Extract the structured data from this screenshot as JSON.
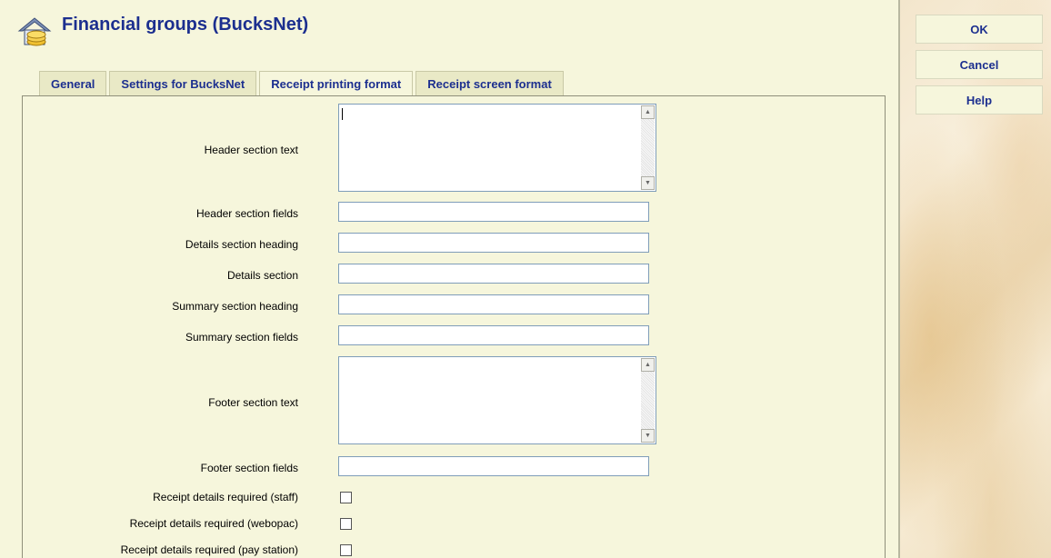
{
  "title": "Financial groups (BucksNet)",
  "tabs": [
    {
      "label": "General"
    },
    {
      "label": "Settings for BucksNet"
    },
    {
      "label": "Receipt printing format"
    },
    {
      "label": "Receipt screen format"
    }
  ],
  "active_tab": "Receipt printing format",
  "form": {
    "header_section_text": {
      "label": "Header section text",
      "value": ""
    },
    "header_section_fields": {
      "label": "Header section fields",
      "value": ""
    },
    "details_section_heading": {
      "label": "Details section heading",
      "value": ""
    },
    "details_section": {
      "label": "Details section",
      "value": ""
    },
    "summary_section_heading": {
      "label": "Summary section heading",
      "value": ""
    },
    "summary_section_fields": {
      "label": "Summary section fields",
      "value": ""
    },
    "footer_section_text": {
      "label": "Footer section text",
      "value": ""
    },
    "footer_section_fields": {
      "label": "Footer section fields",
      "value": ""
    },
    "receipt_staff": {
      "label": "Receipt details required (staff)",
      "checked": false
    },
    "receipt_webopac": {
      "label": "Receipt details required (webopac)",
      "checked": false
    },
    "receipt_pay_station": {
      "label": "Receipt details required (pay station)",
      "checked": false
    }
  },
  "sidebar": {
    "ok_label": "OK",
    "cancel_label": "Cancel",
    "help_label": "Help"
  },
  "icons": {
    "title_icon": "money-house-icon",
    "scroll_up": "scroll-up-arrow-icon",
    "scroll_down": "scroll-down-arrow-icon"
  },
  "colors": {
    "background": "#f6f6dc",
    "title_blue": "#1c2f8f",
    "input_border": "#7f9db9"
  }
}
